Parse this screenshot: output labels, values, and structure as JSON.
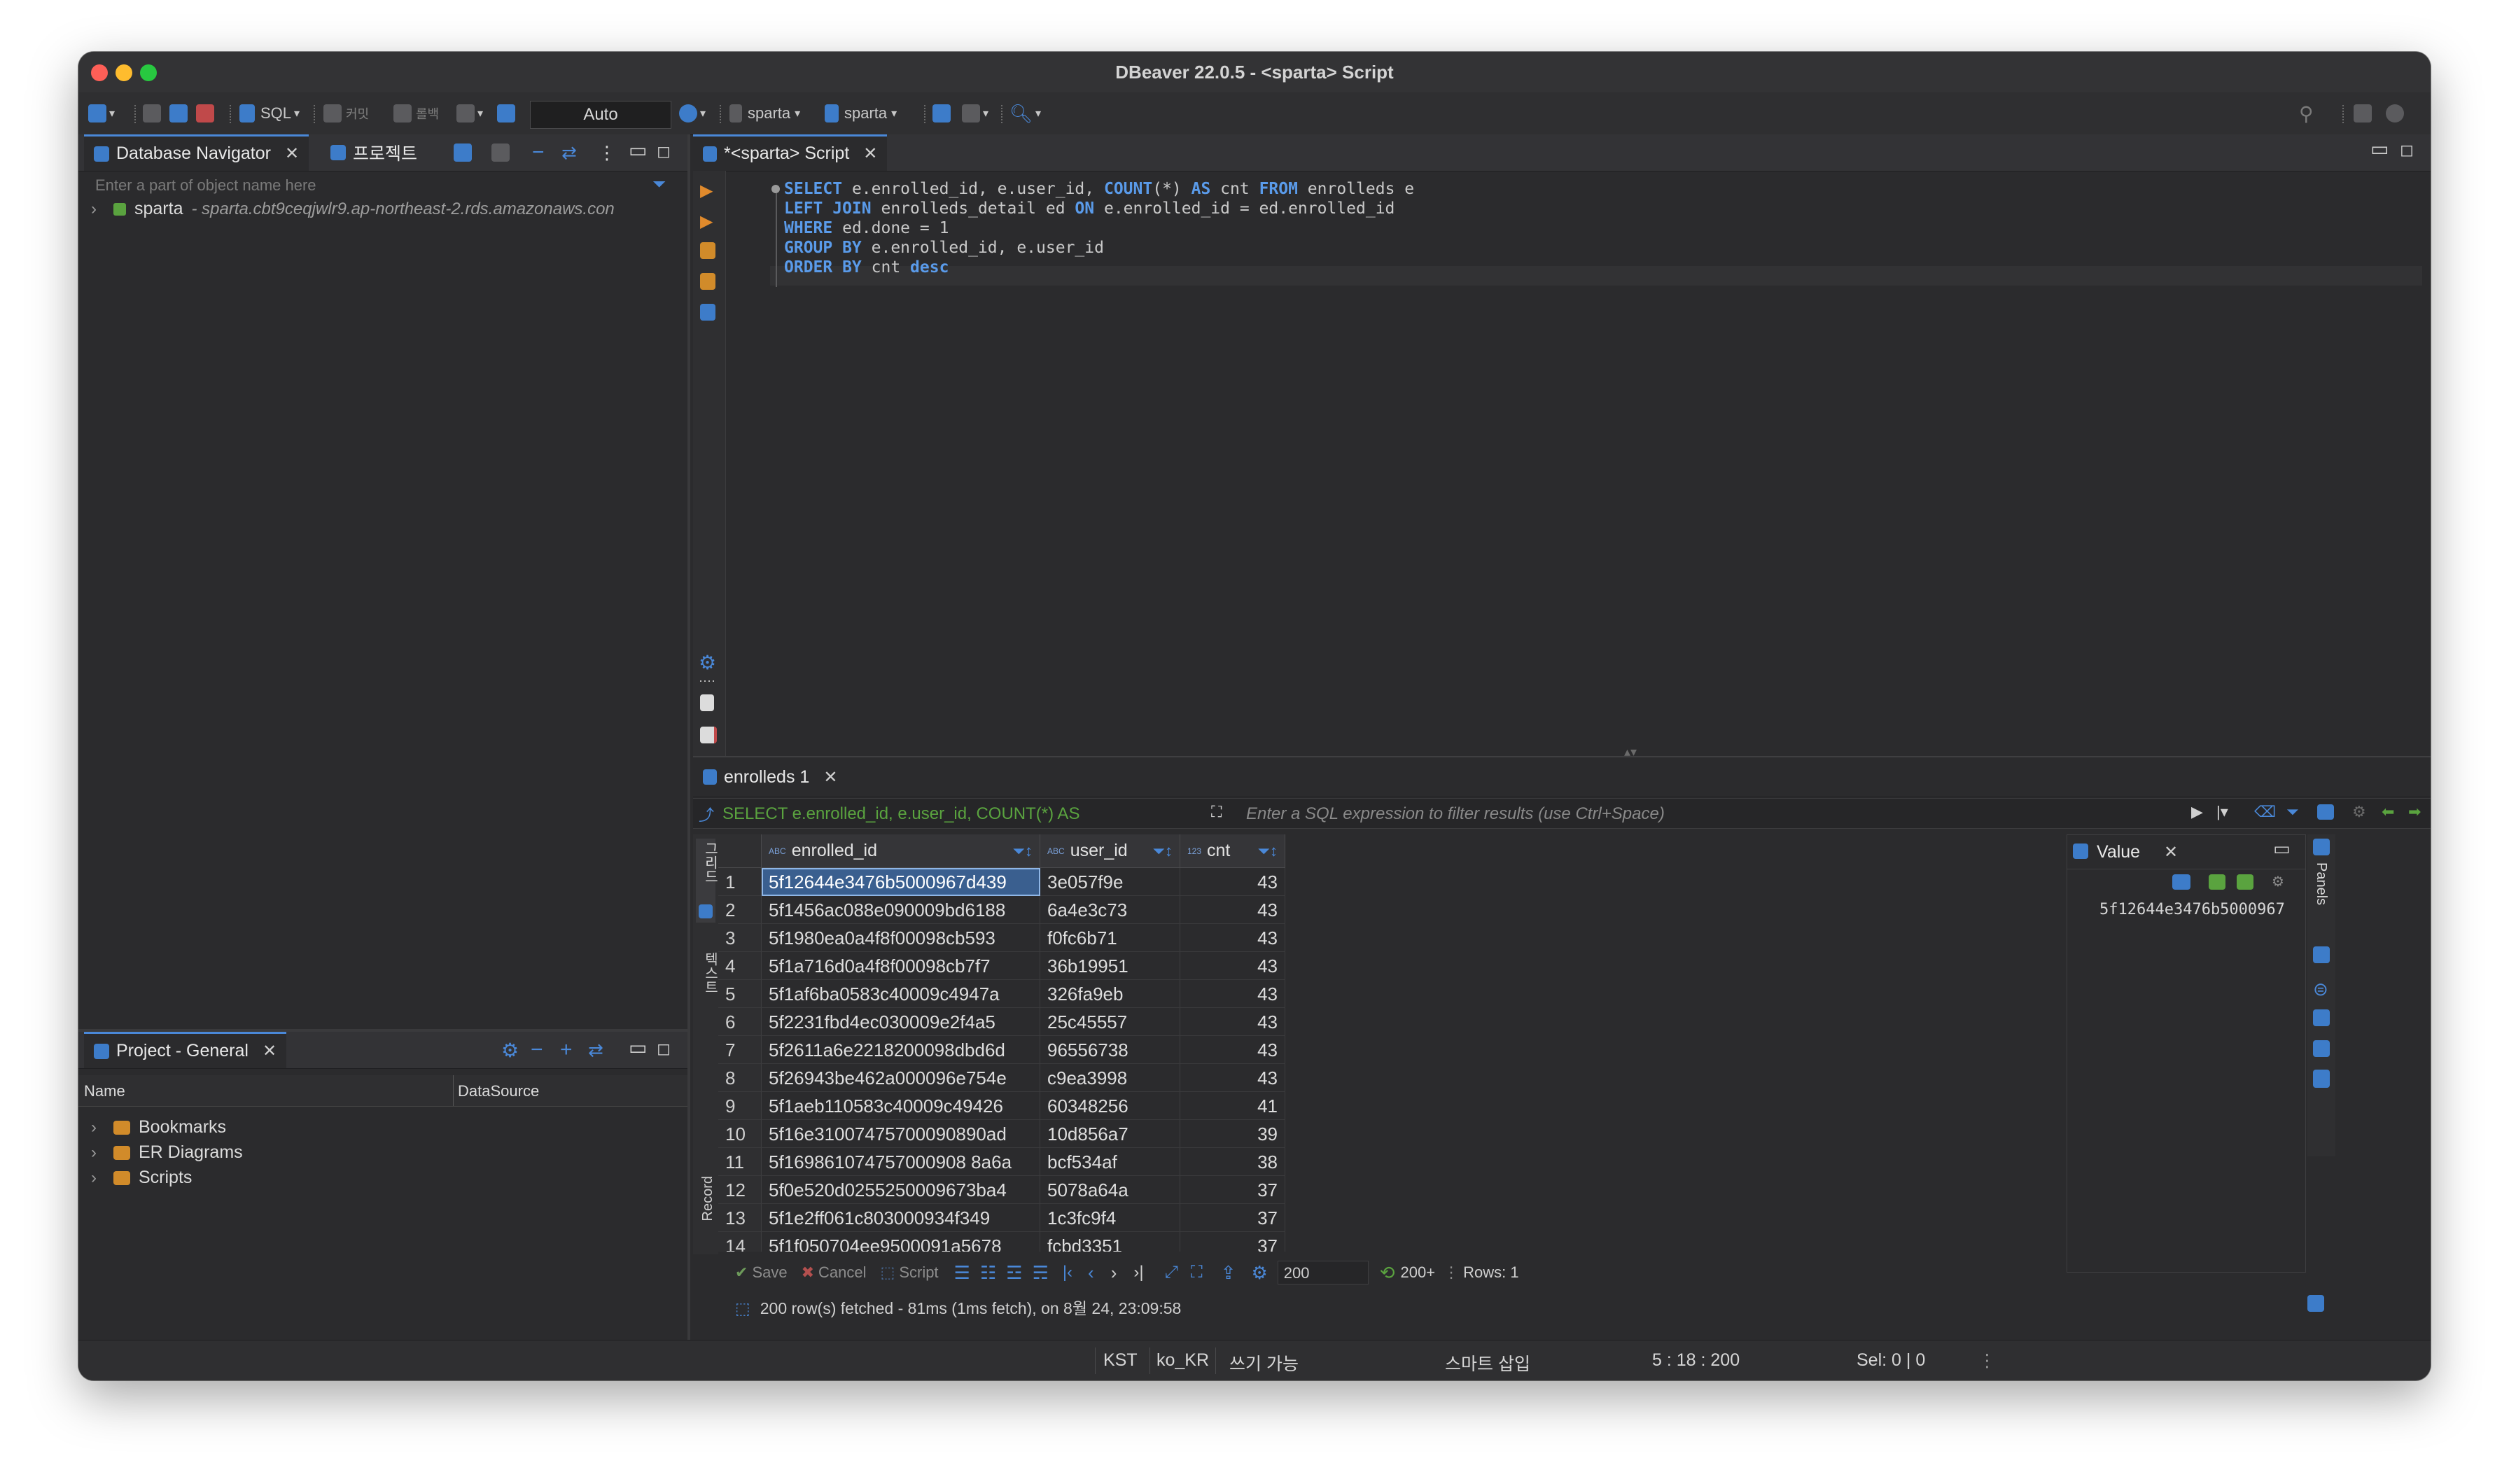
{
  "window": {
    "title": "DBeaver 22.0.5 - <sparta> Script"
  },
  "toolbar": {
    "sql_label": "SQL",
    "commit_label": "커밋",
    "rollback_label": "롤백",
    "transaction_mode": "Auto",
    "datasource_1": "sparta",
    "datasource_2": "sparta"
  },
  "navigator": {
    "tab_label": "Database Navigator",
    "projects_tab_label": "프로젝트",
    "filter_placeholder": "Enter a part of object name here",
    "connection_name": "sparta",
    "connection_host": " - sparta.cbt9ceqjwlr9.ap-northeast-2.rds.amazonaws.con"
  },
  "project": {
    "tab_label": "Project - General",
    "col_name": "Name",
    "col_datasource": "DataSource",
    "items": [
      "Bookmarks",
      "ER Diagrams",
      "Scripts"
    ]
  },
  "editor": {
    "tab_label": "*<sparta> Script",
    "lines": [
      [
        {
          "k": 1,
          "t": "SELECT"
        },
        {
          "k": 0,
          "t": " e.enrolled_id, e.user_id, "
        },
        {
          "k": 1,
          "t": "COUNT"
        },
        {
          "k": 0,
          "t": "(*) "
        },
        {
          "k": 1,
          "t": "AS"
        },
        {
          "k": 0,
          "t": " cnt "
        },
        {
          "k": 1,
          "t": "FROM"
        },
        {
          "k": 0,
          "t": " enrolleds e"
        }
      ],
      [
        {
          "k": 1,
          "t": "LEFT JOIN"
        },
        {
          "k": 0,
          "t": " enrolleds_detail ed "
        },
        {
          "k": 1,
          "t": "ON"
        },
        {
          "k": 0,
          "t": " e.enrolled_id = ed.enrolled_id"
        }
      ],
      [
        {
          "k": 1,
          "t": "WHERE"
        },
        {
          "k": 0,
          "t": " ed.done = 1"
        }
      ],
      [
        {
          "k": 1,
          "t": "GROUP BY"
        },
        {
          "k": 0,
          "t": " e.enrolled_id, e.user_id"
        }
      ],
      [
        {
          "k": 1,
          "t": "ORDER BY"
        },
        {
          "k": 0,
          "t": " cnt "
        },
        {
          "k": 1,
          "t": "desc"
        }
      ]
    ]
  },
  "results": {
    "tab_label": "enrolleds 1",
    "query_preview": "SELECT e.enrolled_id, e.user_id, COUNT(*) AS",
    "filter_placeholder": "Enter a SQL expression to filter results (use Ctrl+Space)",
    "side_tabs": [
      "그리드",
      "텍스트",
      "Record"
    ],
    "columns": [
      {
        "type_badge": "ABC",
        "name": "enrolled_id"
      },
      {
        "type_badge": "ABC",
        "name": "user_id"
      },
      {
        "type_badge": "123",
        "name": "cnt"
      }
    ],
    "rows": [
      [
        "1",
        "5f12644e3476b5000967d439",
        "3e057f9e",
        "43"
      ],
      [
        "2",
        "5f1456ac088e090009bd6188",
        "6a4e3c73",
        "43"
      ],
      [
        "3",
        "5f1980ea0a4f8f00098cb593",
        "f0fc6b71",
        "43"
      ],
      [
        "4",
        "5f1a716d0a4f8f00098cb7f7",
        "36b19951",
        "43"
      ],
      [
        "5",
        "5f1af6ba0583c40009c4947a",
        "326fa9eb",
        "43"
      ],
      [
        "6",
        "5f2231fbd4ec030009e2f4a5",
        "25c45557",
        "43"
      ],
      [
        "7",
        "5f2611a6e2218200098dbd6d",
        "96556738",
        "43"
      ],
      [
        "8",
        "5f26943be462a000096e754e",
        "c9ea3998",
        "43"
      ],
      [
        "9",
        "5f1aeb110583c40009c49426",
        "60348256",
        "41"
      ],
      [
        "10",
        "5f16e31007475700090890ad",
        "10d856a7",
        "39"
      ],
      [
        "11",
        "5f169861074757000908 8a6a",
        "bcf534af",
        "38"
      ],
      [
        "12",
        "5f0e520d0255250009673ba4",
        "5078a64a",
        "37"
      ],
      [
        "13",
        "5f1e2ff061c803000934f349",
        "1c3fc9f4",
        "37"
      ],
      [
        "14",
        "5f1f050704ee9500091a5678",
        "fcbd3351",
        "37"
      ]
    ],
    "value_panel": {
      "title": "Value",
      "content": "5f12644e3476b5000967",
      "side_label": "Panels"
    },
    "bottom": {
      "save": "Save",
      "cancel": "Cancel",
      "script": "Script",
      "fetch_size": "200",
      "fetch_more": "200+",
      "rows_label": "Rows: 1"
    },
    "status_message": "200 row(s) fetched - 81ms (1ms fetch), on 8월 24, 23:09:58"
  },
  "statusbar": {
    "timezone": "KST",
    "locale": "ko_KR",
    "writable": "쓰기 가능",
    "insert_mode": "스마트 삽입",
    "position": "5 : 18 : 200",
    "selection": "Sel: 0 | 0"
  }
}
